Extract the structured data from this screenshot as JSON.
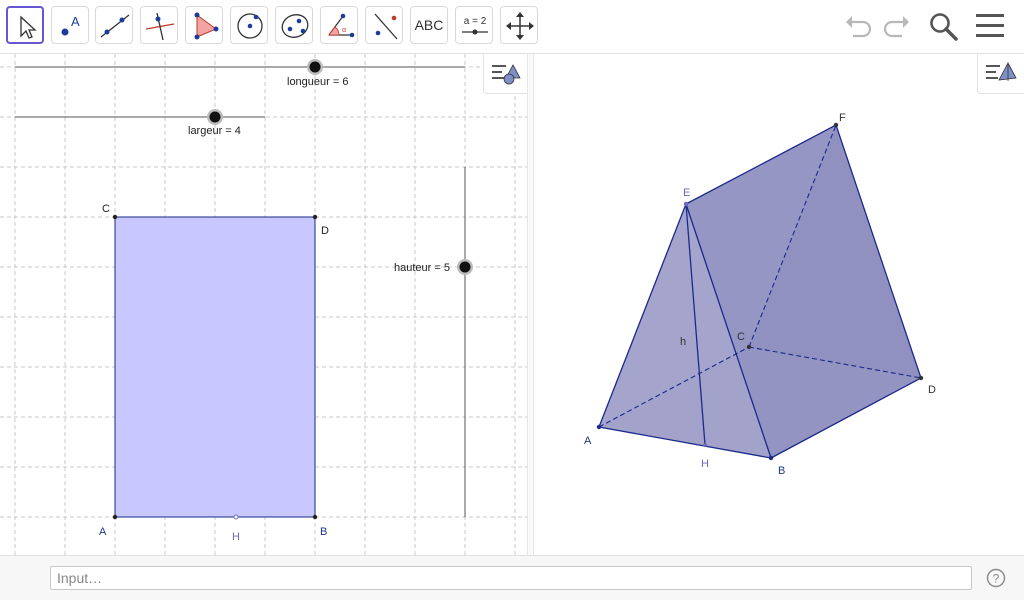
{
  "toolbar": {
    "tools": [
      {
        "name": "move-tool",
        "icon": "arrow-pointer-icon"
      },
      {
        "name": "point-tool",
        "icon": "point-icon"
      },
      {
        "name": "line-tool",
        "icon": "line-through-two-points-icon"
      },
      {
        "name": "perpendicular-line-tool",
        "icon": "perpendicular-line-icon"
      },
      {
        "name": "polygon-tool",
        "icon": "polygon-icon"
      },
      {
        "name": "circle-tool",
        "icon": "circle-center-point-icon"
      },
      {
        "name": "conic-tool",
        "icon": "ellipse-icon"
      },
      {
        "name": "angle-tool",
        "icon": "angle-icon"
      },
      {
        "name": "reflect-tool",
        "icon": "reflect-about-line-icon"
      },
      {
        "name": "text-tool",
        "icon": "text-icon",
        "label": "ABC"
      },
      {
        "name": "slider-tool",
        "icon": "slider-icon",
        "label": "a = 2"
      },
      {
        "name": "move-graphics-view-tool",
        "icon": "move-arrows-icon"
      }
    ],
    "right": [
      "undo-icon",
      "redo-icon",
      "search-icon",
      "menu-icon"
    ]
  },
  "sliders": {
    "longueur": {
      "label": "longueur = 6",
      "value": 6
    },
    "largeur": {
      "label": "largeur = 4",
      "value": 4
    },
    "hauteur": {
      "label": "hauteur = 5",
      "value": 5
    }
  },
  "rectangle_labels": {
    "a": "A",
    "b": "B",
    "c": "C",
    "d": "D",
    "h": "H"
  },
  "prism_labels": {
    "a": "A",
    "b": "B",
    "c": "C",
    "d": "D",
    "e": "E",
    "f": "F",
    "h_point": "H",
    "h_segment": "h"
  },
  "colors": {
    "accent": "#6557d2",
    "rectangle_fill": "#c8c8ff",
    "prism_fill": "#7b7bb5",
    "prism_edge": "#1a2a8a",
    "label_blue": "#1a3a8a",
    "label_light": "#6a6ab8"
  },
  "input_bar": {
    "placeholder": "Input…",
    "help_icon": "help-icon"
  }
}
